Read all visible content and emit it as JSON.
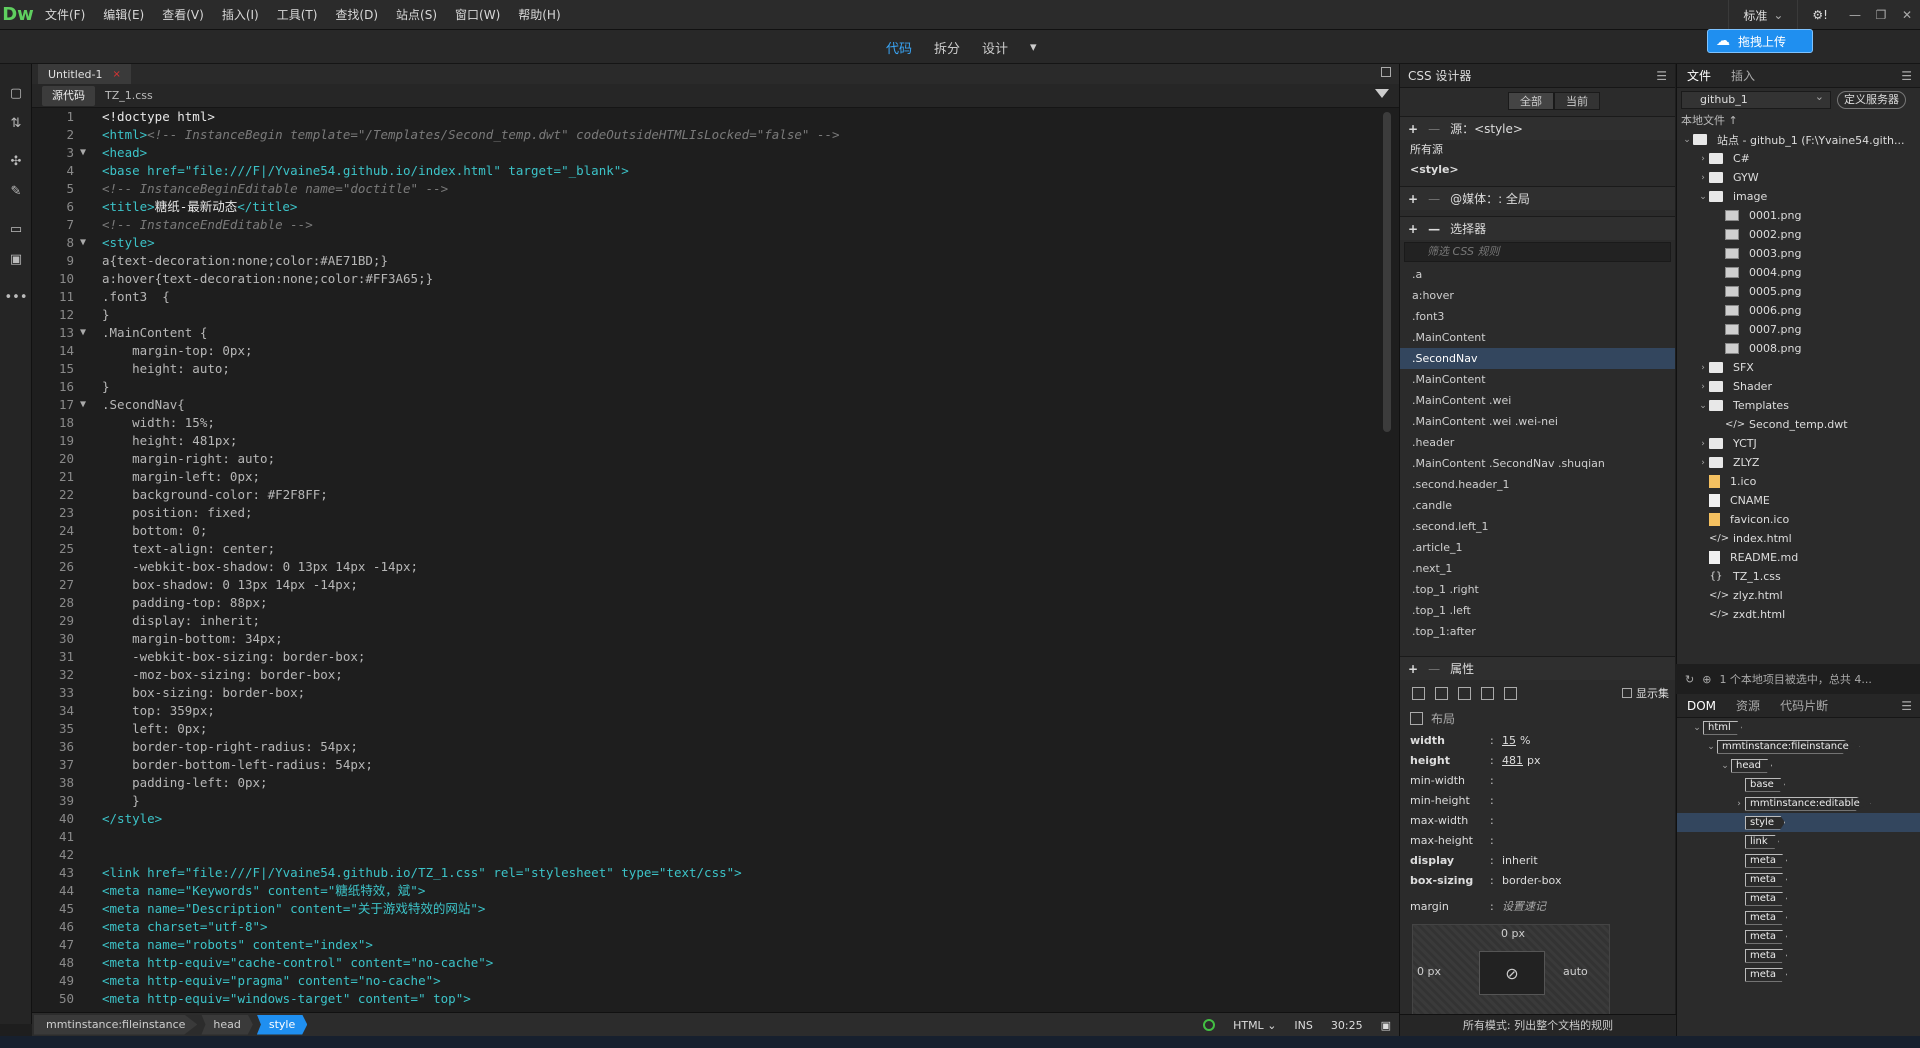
{
  "app": {
    "logo": "Dw",
    "menu": [
      "文件(F)",
      "编辑(E)",
      "查看(V)",
      "插入(I)",
      "工具(T)",
      "查找(D)",
      "站点(S)",
      "窗口(W)",
      "帮助(H)"
    ],
    "workspace": "标准",
    "gear": "⚙!"
  },
  "viewbar": {
    "code": "代码",
    "split": "拆分",
    "design": "设计",
    "upload": "拖拽上传"
  },
  "document": {
    "tab_title": "Untitled-1",
    "tab_close": "×",
    "subtab_source": "源代码",
    "subtab_css": "TZ_1.css"
  },
  "code_lines": [
    {
      "n": "1",
      "fold": "",
      "parts": [
        {
          "c": "c-txt",
          "t": "<!doctype html>"
        }
      ]
    },
    {
      "n": "2",
      "fold": "",
      "parts": [
        {
          "c": "c-tag",
          "t": "<html>"
        },
        {
          "c": "c-com",
          "t": "<!-- InstanceBegin template=\"/Templates/Second_temp.dwt\" codeOutsideHTMLIsLocked=\"false\" -->"
        }
      ]
    },
    {
      "n": "3",
      "fold": "▼",
      "parts": [
        {
          "c": "c-tag",
          "t": "<head>"
        }
      ]
    },
    {
      "n": "4",
      "fold": "",
      "parts": [
        {
          "c": "c-tag",
          "t": "<base href=\"file:///F|/Yvaine54.github.io/index.html\" target=\"_blank\">"
        }
      ]
    },
    {
      "n": "5",
      "fold": "",
      "parts": [
        {
          "c": "c-com",
          "t": "<!-- InstanceBeginEditable name=\"doctitle\" -->"
        }
      ]
    },
    {
      "n": "6",
      "fold": "",
      "parts": [
        {
          "c": "c-tag",
          "t": "<title>"
        },
        {
          "c": "c-txt",
          "t": "糖纸-最新动态"
        },
        {
          "c": "c-tag",
          "t": "</title>"
        }
      ]
    },
    {
      "n": "7",
      "fold": "",
      "parts": [
        {
          "c": "c-com",
          "t": "<!-- InstanceEndEditable -->"
        }
      ]
    },
    {
      "n": "8",
      "fold": "▼",
      "parts": [
        {
          "c": "c-tag",
          "t": "<style>"
        }
      ]
    },
    {
      "n": "9",
      "fold": "",
      "parts": [
        {
          "c": "c-css",
          "t": "a{text-decoration:none;color:#AE71BD;}"
        }
      ]
    },
    {
      "n": "10",
      "fold": "",
      "parts": [
        {
          "c": "c-css",
          "t": "a:hover{text-decoration:none;color:#FF3A65;}"
        }
      ]
    },
    {
      "n": "11",
      "fold": "",
      "parts": [
        {
          "c": "c-css",
          "t": ".font3  {"
        }
      ]
    },
    {
      "n": "12",
      "fold": "",
      "parts": [
        {
          "c": "c-css",
          "t": "}"
        }
      ]
    },
    {
      "n": "13",
      "fold": "▼",
      "parts": [
        {
          "c": "c-css",
          "t": ".MainContent {"
        }
      ]
    },
    {
      "n": "14",
      "fold": "",
      "parts": [
        {
          "c": "c-css",
          "t": "    margin-top: 0px;"
        }
      ]
    },
    {
      "n": "15",
      "fold": "",
      "parts": [
        {
          "c": "c-css",
          "t": "    height: auto;"
        }
      ]
    },
    {
      "n": "16",
      "fold": "",
      "parts": [
        {
          "c": "c-css",
          "t": "}"
        }
      ]
    },
    {
      "n": "17",
      "fold": "▼",
      "parts": [
        {
          "c": "c-css",
          "t": ".SecondNav{"
        }
      ]
    },
    {
      "n": "18",
      "fold": "",
      "parts": [
        {
          "c": "c-css",
          "t": "    width: 15%;"
        }
      ]
    },
    {
      "n": "19",
      "fold": "",
      "parts": [
        {
          "c": "c-css",
          "t": "    height: 481px;"
        }
      ]
    },
    {
      "n": "20",
      "fold": "",
      "parts": [
        {
          "c": "c-css",
          "t": "    margin-right: auto;"
        }
      ]
    },
    {
      "n": "21",
      "fold": "",
      "parts": [
        {
          "c": "c-css",
          "t": "    margin-left: 0px;"
        }
      ]
    },
    {
      "n": "22",
      "fold": "",
      "parts": [
        {
          "c": "c-css",
          "t": "    background-color: #F2F8FF;"
        }
      ]
    },
    {
      "n": "23",
      "fold": "",
      "parts": [
        {
          "c": "c-css",
          "t": "    position: fixed;"
        }
      ]
    },
    {
      "n": "24",
      "fold": "",
      "parts": [
        {
          "c": "c-css",
          "t": "    bottom: 0;"
        }
      ]
    },
    {
      "n": "25",
      "fold": "",
      "parts": [
        {
          "c": "c-css",
          "t": "    text-align: center;"
        }
      ]
    },
    {
      "n": "26",
      "fold": "",
      "parts": [
        {
          "c": "c-css",
          "t": "    -webkit-box-shadow: 0 13px 14px -14px;"
        }
      ]
    },
    {
      "n": "27",
      "fold": "",
      "parts": [
        {
          "c": "c-css",
          "t": "    box-shadow: 0 13px 14px -14px;"
        }
      ]
    },
    {
      "n": "28",
      "fold": "",
      "parts": [
        {
          "c": "c-css",
          "t": "    padding-top: 88px;"
        }
      ]
    },
    {
      "n": "29",
      "fold": "",
      "parts": [
        {
          "c": "c-css",
          "t": "    display: inherit;"
        }
      ]
    },
    {
      "n": "30",
      "fold": "",
      "parts": [
        {
          "c": "c-css",
          "t": "    margin-bottom: 34px;"
        }
      ]
    },
    {
      "n": "31",
      "fold": "",
      "parts": [
        {
          "c": "c-css",
          "t": "    -webkit-box-sizing: border-box;"
        }
      ]
    },
    {
      "n": "32",
      "fold": "",
      "parts": [
        {
          "c": "c-css",
          "t": "    -moz-box-sizing: border-box;"
        }
      ]
    },
    {
      "n": "33",
      "fold": "",
      "parts": [
        {
          "c": "c-css",
          "t": "    box-sizing: border-box;"
        }
      ]
    },
    {
      "n": "34",
      "fold": "",
      "parts": [
        {
          "c": "c-css",
          "t": "    top: 359px;"
        }
      ]
    },
    {
      "n": "35",
      "fold": "",
      "parts": [
        {
          "c": "c-css",
          "t": "    left: 0px;"
        }
      ]
    },
    {
      "n": "36",
      "fold": "",
      "parts": [
        {
          "c": "c-css",
          "t": "    border-top-right-radius: 54px;"
        }
      ]
    },
    {
      "n": "37",
      "fold": "",
      "parts": [
        {
          "c": "c-css",
          "t": "    border-bottom-left-radius: 54px;"
        }
      ]
    },
    {
      "n": "38",
      "fold": "",
      "parts": [
        {
          "c": "c-css",
          "t": "    padding-left: 0px;"
        }
      ]
    },
    {
      "n": "39",
      "fold": "",
      "parts": [
        {
          "c": "c-css",
          "t": "    }"
        }
      ]
    },
    {
      "n": "40",
      "fold": "",
      "parts": [
        {
          "c": "c-tag",
          "t": "</style>"
        }
      ]
    },
    {
      "n": "41",
      "fold": "",
      "parts": []
    },
    {
      "n": "42",
      "fold": "",
      "parts": []
    },
    {
      "n": "43",
      "fold": "",
      "parts": [
        {
          "c": "c-tag",
          "t": "<link href=\"file:///F|/Yvaine54.github.io/TZ_1.css\" rel=\"stylesheet\" type=\"text/css\">"
        }
      ]
    },
    {
      "n": "44",
      "fold": "",
      "parts": [
        {
          "c": "c-tag",
          "t": "<meta name=\"Keywords\" content=\"糖纸特效，斌\">"
        }
      ]
    },
    {
      "n": "45",
      "fold": "",
      "parts": [
        {
          "c": "c-tag",
          "t": "<meta name=\"Description\" content=\"关于游戏特效的网站\">"
        }
      ]
    },
    {
      "n": "46",
      "fold": "",
      "parts": [
        {
          "c": "c-tag",
          "t": "<meta charset=\"utf-8\">"
        }
      ]
    },
    {
      "n": "47",
      "fold": "",
      "parts": [
        {
          "c": "c-tag",
          "t": "<meta name=\"robots\" content=\"index\">"
        }
      ]
    },
    {
      "n": "48",
      "fold": "",
      "parts": [
        {
          "c": "c-tag",
          "t": "<meta http-equiv=\"cache-control\" content=\"no-cache\">"
        }
      ]
    },
    {
      "n": "49",
      "fold": "",
      "parts": [
        {
          "c": "c-tag",
          "t": "<meta http-equiv=\"pragma\" content=\"no-cache\">"
        }
      ]
    },
    {
      "n": "50",
      "fold": "",
      "parts": [
        {
          "c": "c-tag",
          "t": "<meta http-equiv=\"windows-target\" content=\" top\">"
        }
      ]
    }
  ],
  "statusbar": {
    "crumbs": [
      "mmtinstance:fileinstance",
      "head",
      "style"
    ],
    "lang": "HTML",
    "mode": "INS",
    "position": "30:25"
  },
  "css_designer": {
    "title": "CSS 设计器",
    "toggle_all": "全部",
    "toggle_current": "当前",
    "source_label": "源：<style>",
    "sources": [
      "所有源",
      "<style>"
    ],
    "media_label": "@媒体：: 全局",
    "selector_label": "选择器",
    "filter_placeholder": "筛选 CSS 规则",
    "selectors": [
      ".a",
      "a:hover",
      ".font3",
      ".MainContent",
      ".SecondNav",
      ".MainContent",
      ".MainContent .wei",
      ".MainContent .wei .wei-nei",
      ".header",
      ".MainContent .SecondNav .shuqian",
      ".second.header_1",
      ".candle",
      ".second.left_1",
      ".article_1",
      ".next_1",
      ".top_1 .right",
      ".top_1 .left",
      ".top_1:after"
    ],
    "selected_index": 4,
    "props_label": "属性",
    "show_set": "显示集",
    "layout_label": "布局",
    "props": [
      {
        "name": "width",
        "bold": true,
        "val": "15",
        "unit": "%"
      },
      {
        "name": "height",
        "bold": true,
        "val": "481",
        "unit": "px"
      },
      {
        "name": "min-width",
        "bold": false,
        "val": "",
        "unit": ""
      },
      {
        "name": "min-height",
        "bold": false,
        "val": "",
        "unit": ""
      },
      {
        "name": "max-width",
        "bold": false,
        "val": "",
        "unit": ""
      },
      {
        "name": "max-height",
        "bold": false,
        "val": "",
        "unit": ""
      },
      {
        "name": "display",
        "bold": true,
        "val": "inherit",
        "unit": ""
      },
      {
        "name": "box-sizing",
        "bold": true,
        "val": "border-box",
        "unit": ""
      }
    ],
    "margin_label": "margin",
    "margin_hint": "设置速记",
    "margin_top": "0 px",
    "margin_left": "0 px",
    "margin_right": "auto",
    "footer": "所有模式: 列出整个文档的规则"
  },
  "files": {
    "tab_files": "文件",
    "tab_insert": "插入",
    "site": "github_1",
    "define_server": "定义服务器",
    "local_files": "本地文件 ↑",
    "tree": [
      {
        "d": 0,
        "caret": "⌄",
        "icon": "folder",
        "label": "站点 - github_1 (F:\\Yvaine54.gith..."
      },
      {
        "d": 1,
        "caret": "›",
        "icon": "folder",
        "label": "C#"
      },
      {
        "d": 1,
        "caret": "›",
        "icon": "folder",
        "label": "GYW"
      },
      {
        "d": 1,
        "caret": "⌄",
        "icon": "folder",
        "label": "image"
      },
      {
        "d": 2,
        "caret": "",
        "icon": "img",
        "label": "0001.png"
      },
      {
        "d": 2,
        "caret": "",
        "icon": "img",
        "label": "0002.png"
      },
      {
        "d": 2,
        "caret": "",
        "icon": "img",
        "label": "0003.png"
      },
      {
        "d": 2,
        "caret": "",
        "icon": "img",
        "label": "0004.png"
      },
      {
        "d": 2,
        "caret": "",
        "icon": "img",
        "label": "0005.png"
      },
      {
        "d": 2,
        "caret": "",
        "icon": "img",
        "label": "0006.png"
      },
      {
        "d": 2,
        "caret": "",
        "icon": "img",
        "label": "0007.png"
      },
      {
        "d": 2,
        "caret": "",
        "icon": "img",
        "label": "0008.png"
      },
      {
        "d": 1,
        "caret": "›",
        "icon": "folder",
        "label": "SFX"
      },
      {
        "d": 1,
        "caret": "›",
        "icon": "folder",
        "label": "Shader"
      },
      {
        "d": 1,
        "caret": "⌄",
        "icon": "folder",
        "label": "Templates"
      },
      {
        "d": 2,
        "caret": "",
        "icon": "code",
        "label": "Second_temp.dwt"
      },
      {
        "d": 1,
        "caret": "›",
        "icon": "folder",
        "label": "YCTJ"
      },
      {
        "d": 1,
        "caret": "›",
        "icon": "folder",
        "label": "ZLYZ"
      },
      {
        "d": 1,
        "caret": "",
        "icon": "ico",
        "label": "1.ico"
      },
      {
        "d": 1,
        "caret": "",
        "icon": "file",
        "label": "CNAME"
      },
      {
        "d": 1,
        "caret": "",
        "icon": "ico",
        "label": "favicon.ico"
      },
      {
        "d": 1,
        "caret": "",
        "icon": "code",
        "label": "index.html"
      },
      {
        "d": 1,
        "caret": "",
        "icon": "file",
        "label": "README.md"
      },
      {
        "d": 1,
        "caret": "",
        "icon": "css",
        "label": "TZ_1.css"
      },
      {
        "d": 1,
        "caret": "",
        "icon": "code",
        "label": "zlyz.html"
      },
      {
        "d": 1,
        "caret": "",
        "icon": "code",
        "label": "zxdt.html"
      }
    ],
    "footer": "1 个本地项目被选中，总共 4..."
  },
  "dom": {
    "tab_dom": "DOM",
    "tab_assets": "资源",
    "tab_snippets": "代码片断",
    "nodes": [
      {
        "d": 0,
        "caret": "⌄",
        "label": "html",
        "sel": false
      },
      {
        "d": 1,
        "caret": "⌄",
        "label": "mmtinstance:fileinstance",
        "sel": false
      },
      {
        "d": 2,
        "caret": "⌄",
        "label": "head",
        "sel": false
      },
      {
        "d": 3,
        "caret": "",
        "label": "base",
        "sel": false
      },
      {
        "d": 3,
        "caret": "›",
        "label": "mmtinstance:editable",
        "sel": false
      },
      {
        "d": 3,
        "caret": "",
        "label": "style",
        "sel": true
      },
      {
        "d": 3,
        "caret": "",
        "label": "link",
        "sel": false
      },
      {
        "d": 3,
        "caret": "",
        "label": "meta",
        "sel": false
      },
      {
        "d": 3,
        "caret": "",
        "label": "meta",
        "sel": false
      },
      {
        "d": 3,
        "caret": "",
        "label": "meta",
        "sel": false
      },
      {
        "d": 3,
        "caret": "",
        "label": "meta",
        "sel": false
      },
      {
        "d": 3,
        "caret": "",
        "label": "meta",
        "sel": false
      },
      {
        "d": 3,
        "caret": "",
        "label": "meta",
        "sel": false
      },
      {
        "d": 3,
        "caret": "",
        "label": "meta",
        "sel": false
      }
    ]
  }
}
